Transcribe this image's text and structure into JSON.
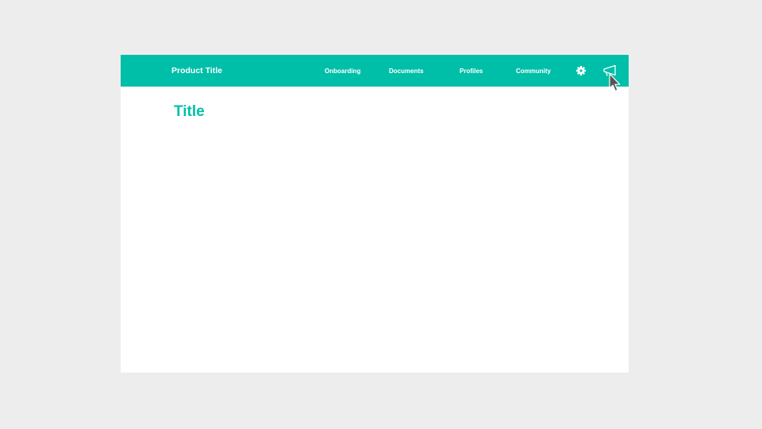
{
  "header": {
    "product_title": "Product Title",
    "nav": [
      {
        "label": "Onboarding"
      },
      {
        "label": "Documents"
      },
      {
        "label": "Profiles"
      },
      {
        "label": "Community"
      }
    ],
    "icons": [
      "gear-icon",
      "megaphone-icon"
    ]
  },
  "main": {
    "title": "Title"
  },
  "colors": {
    "accent": "#00bfa9",
    "background": "#ededed",
    "surface": "#ffffff"
  }
}
